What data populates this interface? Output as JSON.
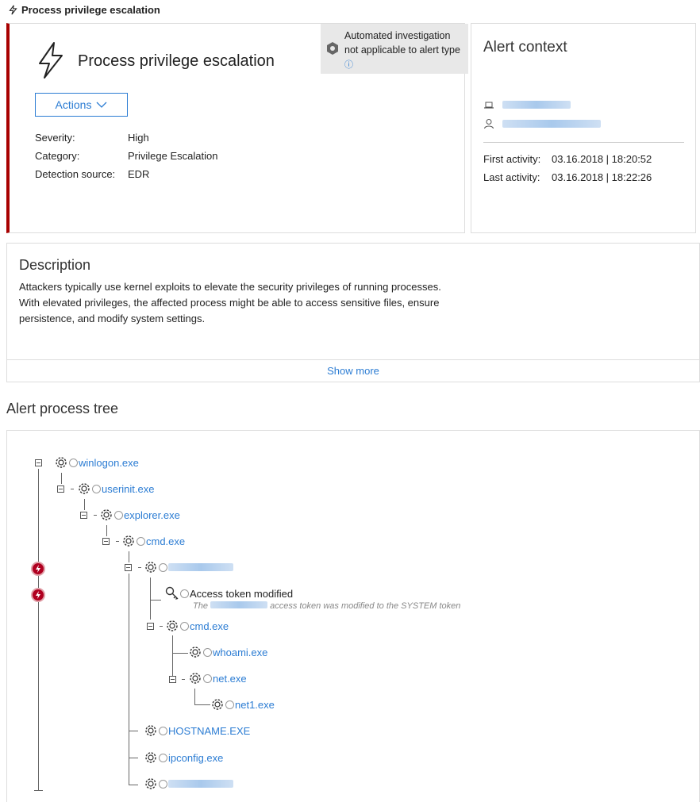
{
  "breadcrumb": {
    "title": "Process privilege escalation"
  },
  "alert": {
    "title": "Process privilege escalation",
    "automated_investigation": "Automated investigation not applicable to alert type",
    "info_glyph": "ⓘ",
    "actions_label": "Actions",
    "properties": [
      {
        "key": "Severity:",
        "value": "High"
      },
      {
        "key": "Category:",
        "value": "Privilege Escalation"
      },
      {
        "key": "Detection source:",
        "value": "EDR"
      }
    ]
  },
  "context": {
    "title": "Alert context",
    "first_activity_label": "First activity:",
    "first_activity_value": "03.16.2018 | 18:20:52",
    "last_activity_label": "Last activity:",
    "last_activity_value": "03.16.2018 | 18:22:26"
  },
  "description": {
    "title": "Description",
    "text": "Attackers typically use kernel exploits to elevate the security privileges of running processes. With elevated privileges, the affected process might be able to access sensitive files, ensure persistence, and modify system settings.",
    "show_more": "Show more"
  },
  "tree": {
    "title": "Alert process tree",
    "nodes": [
      {
        "label": "winlogon.exe"
      },
      {
        "label": "userinit.exe"
      },
      {
        "label": "explorer.exe"
      },
      {
        "label": "cmd.exe"
      },
      {
        "label": ""
      },
      {
        "label": "Access token modified"
      },
      {
        "label": "cmd.exe"
      },
      {
        "label": "whoami.exe"
      },
      {
        "label": "net.exe"
      },
      {
        "label": "net1.exe"
      },
      {
        "label": "HOSTNAME.EXE"
      },
      {
        "label": "ipconfig.exe"
      },
      {
        "label": ""
      }
    ],
    "event_detail_prefix": "The",
    "event_detail_suffix": "access token was modified to the SYSTEM token"
  },
  "colors": {
    "link": "#2b7cd3",
    "severity_bar": "#a80000",
    "alert_marker": "#b00020"
  }
}
